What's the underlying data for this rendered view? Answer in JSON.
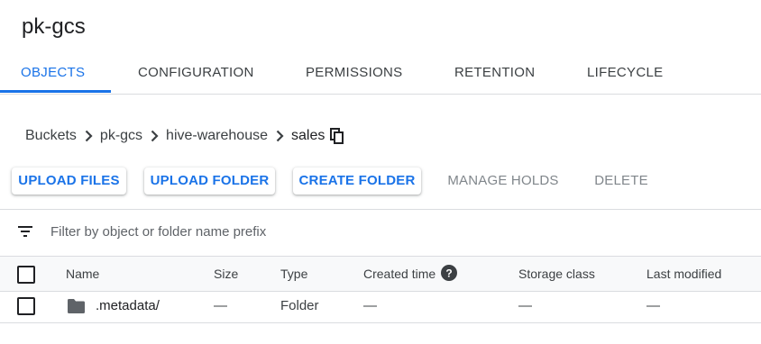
{
  "bucket_title": "pk-gcs",
  "tabs": [
    {
      "label": "OBJECTS",
      "active": true
    },
    {
      "label": "CONFIGURATION",
      "active": false
    },
    {
      "label": "PERMISSIONS",
      "active": false
    },
    {
      "label": "RETENTION",
      "active": false
    },
    {
      "label": "LIFECYCLE",
      "active": false
    }
  ],
  "breadcrumb": {
    "items": [
      "Buckets",
      "pk-gcs",
      "hive-warehouse",
      "sales"
    ],
    "separator_icon": "chevron-right-icon",
    "copy_icon": "copy-path-icon"
  },
  "actions": {
    "upload_files": "UPLOAD FILES",
    "upload_folder": "UPLOAD FOLDER",
    "create_folder": "CREATE FOLDER",
    "manage_holds": "MANAGE HOLDS",
    "delete": "DELETE"
  },
  "filter": {
    "icon": "filter-list-icon",
    "placeholder": "Filter by object or folder name prefix",
    "value": ""
  },
  "table": {
    "columns": {
      "name": "Name",
      "size": "Size",
      "type": "Type",
      "created_time": "Created time",
      "storage_class": "Storage class",
      "last_modified": "Last modified"
    },
    "rows": [
      {
        "icon": "folder-icon",
        "name": ".metadata/",
        "size": "—",
        "type": "Folder",
        "created_time": "—",
        "storage_class": "—",
        "last_modified": "—"
      }
    ]
  },
  "colors": {
    "accent": "#1a73e8",
    "text": "#202124",
    "muted": "#80868b",
    "border": "#dadce0",
    "header_bg": "#f8f9fa"
  }
}
